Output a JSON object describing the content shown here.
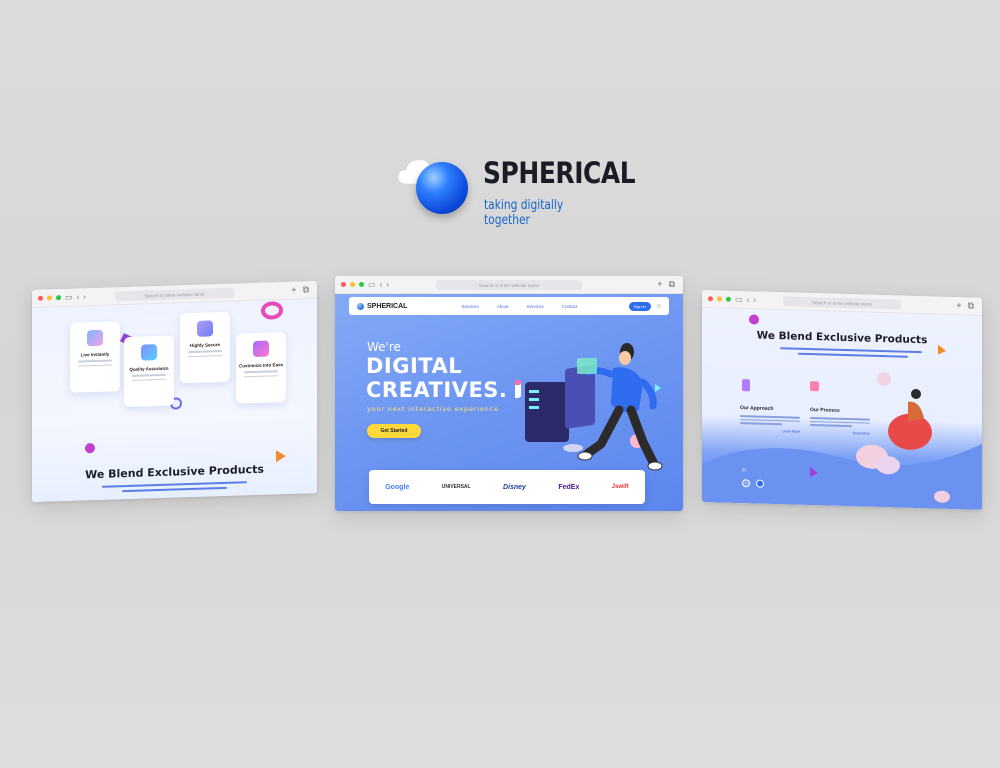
{
  "brand": {
    "name": "SPHERICAL",
    "tagline": "taking digitally together"
  },
  "browser": {
    "url_placeholder": "Search or enter website name"
  },
  "left_page": {
    "cards": [
      {
        "label": "Live Instantly"
      },
      {
        "label": "Quality Assurance"
      },
      {
        "label": "Highly Secure"
      },
      {
        "label": "Customize Into Ease"
      }
    ],
    "heading": "We Blend Exclusive Products"
  },
  "center_page": {
    "nav": {
      "brand": "SPHERICAL",
      "links": [
        "Services",
        "About",
        "Services",
        "Contact"
      ],
      "signin": "Sign in"
    },
    "hero": {
      "eyebrow": "We're",
      "headline_1": "DIGITAL",
      "headline_2": "CREATIVES.",
      "tagline": "your next interactive experience",
      "cta": "Get Started"
    },
    "partners": [
      "Google",
      "UNIVERSAL",
      "Disney",
      "FedEx",
      "Jswift"
    ]
  },
  "right_page": {
    "heading": "We Blend Exclusive Products",
    "columns": [
      {
        "title": "Our Approach",
        "more": "Learn More"
      },
      {
        "title": "Our Process",
        "more": "Read More"
      }
    ],
    "page_indicator": "01"
  },
  "colors": {
    "accent": "#2f6cf0",
    "hero_blue": "#6e97f2",
    "cta_yellow": "#ffd83a"
  }
}
